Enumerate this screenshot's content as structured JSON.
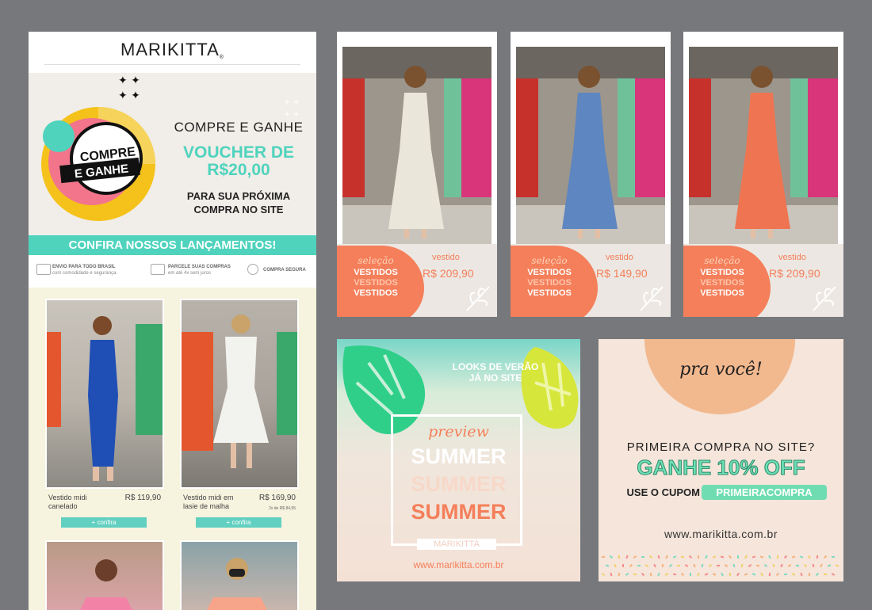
{
  "colors": {
    "background": "#77787c",
    "teal": "#4fd3bd",
    "coral": "#f47f5a",
    "cream": "#f6f3de"
  },
  "newsletter": {
    "logo": "MARIKITTA",
    "logo_mark": "®",
    "hero": {
      "badge_line1": "COMPRE",
      "badge_line2": "E GANHE",
      "headline": "COMPRE E GANHE",
      "voucher_line1": "VOUCHER DE",
      "voucher_line2": "R$20,00",
      "sub_line1": "PARA SUA PRÓXIMA",
      "sub_line2": "COMPRA NO SITE"
    },
    "cta": "CONFIRA NOSSOS LANÇAMENTOS!",
    "features": [
      {
        "title": "ENVIO PARA TODO BRASIL",
        "text": "com comodidade e segurança.",
        "icon": "truck-icon"
      },
      {
        "title": "PARCELE SUAS COMPRAS",
        "text": "em até 4x sem juros",
        "icon": "credit-card-icon"
      },
      {
        "title": "COMPRA SEGURA",
        "text": "",
        "icon": "lock-icon"
      }
    ],
    "products": [
      {
        "name": "Vestido midi canelado",
        "price": "R$ 119,90",
        "installment": "",
        "button": "+ confira"
      },
      {
        "name": "Vestido midi em lasie de malha",
        "price": "R$ 169,90",
        "installment": "2x de R$ 84,95",
        "button": "+ confira"
      }
    ]
  },
  "posts": [
    {
      "selecao": "seleção",
      "words": [
        "VESTIDOS",
        "VESTIDOS",
        "VESTIDOS"
      ],
      "label": "vestido",
      "price": "R$ 209,90",
      "dress_color": "#ebe6da"
    },
    {
      "selecao": "seleção",
      "words": [
        "VESTIDOS",
        "VESTIDOS",
        "VESTIDOS"
      ],
      "label": "vestido",
      "price": "R$ 149,90",
      "dress_color": "#5e86c0"
    },
    {
      "selecao": "seleção",
      "words": [
        "VESTIDOS",
        "VESTIDOS",
        "VESTIDOS"
      ],
      "label": "vestido",
      "price": "R$ 209,90",
      "dress_color": "#ef7451"
    }
  ],
  "summer": {
    "tag_line1": "LOOKS DE VERÃO",
    "tag_line2": "JÁ NO SITE",
    "preview": "preview",
    "words": [
      "SUMMER",
      "SUMMER",
      "SUMMER"
    ],
    "brand": "MARIKITTA",
    "url": "www.marikitta.com.br"
  },
  "coupon": {
    "script": "pra você!",
    "question": "PRIMEIRA COMPRA NO SITE?",
    "offer": "GANHE 10% OFF",
    "use": "USE O CUPOM",
    "code": "PRIMEIRACOMPRA",
    "url": "www.marikitta.com.br"
  }
}
